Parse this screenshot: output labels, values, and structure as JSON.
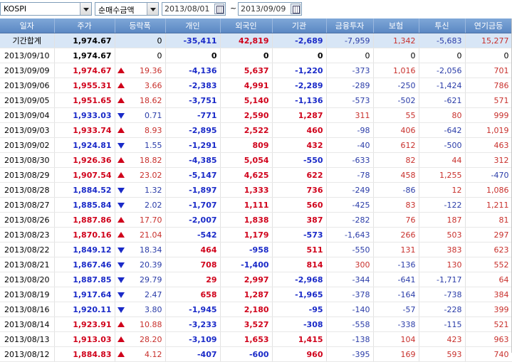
{
  "toolbar": {
    "market": "KOSPI",
    "mode": "순매수금액",
    "start_date": "2013/08/01",
    "separator": "~",
    "end_date": "2013/09/09"
  },
  "columns": [
    "일자",
    "주가",
    "등락폭",
    "개인",
    "외국인",
    "기관",
    "금융투자",
    "보험",
    "투신",
    "연기금등"
  ],
  "rows": [
    {
      "date": "기간합계",
      "close": "1,974.67",
      "dir": "none",
      "chg": "0",
      "ind": "-35,411",
      "for": "42,819",
      "inst": "-2,689",
      "fin": "-7,959",
      "ins": "1,342",
      "trust": "-5,683",
      "pen": "15,277",
      "summary": true
    },
    {
      "date": "2013/09/10",
      "close": "1,974.67",
      "dir": "none",
      "chg": "0",
      "ind": "0",
      "for": "0",
      "inst": "0",
      "fin": "0",
      "ins": "0",
      "trust": "0",
      "pen": "0"
    },
    {
      "date": "2013/09/09",
      "close": "1,974.67",
      "dir": "up",
      "chg": "19.36",
      "ind": "-4,136",
      "for": "5,637",
      "inst": "-1,220",
      "fin": "-373",
      "ins": "1,016",
      "trust": "-2,056",
      "pen": "701"
    },
    {
      "date": "2013/09/06",
      "close": "1,955.31",
      "dir": "up",
      "chg": "3.66",
      "ind": "-2,383",
      "for": "4,991",
      "inst": "-2,289",
      "fin": "-289",
      "ins": "-250",
      "trust": "-1,424",
      "pen": "786"
    },
    {
      "date": "2013/09/05",
      "close": "1,951.65",
      "dir": "up",
      "chg": "18.62",
      "ind": "-3,751",
      "for": "5,140",
      "inst": "-1,136",
      "fin": "-573",
      "ins": "-502",
      "trust": "-621",
      "pen": "571"
    },
    {
      "date": "2013/09/04",
      "close": "1,933.03",
      "dir": "down",
      "chg": "0.71",
      "ind": "-771",
      "for": "2,590",
      "inst": "1,287",
      "fin": "311",
      "ins": "55",
      "trust": "80",
      "pen": "999"
    },
    {
      "date": "2013/09/03",
      "close": "1,933.74",
      "dir": "up",
      "chg": "8.93",
      "ind": "-2,895",
      "for": "2,522",
      "inst": "460",
      "fin": "-98",
      "ins": "406",
      "trust": "-642",
      "pen": "1,019"
    },
    {
      "date": "2013/09/02",
      "close": "1,924.81",
      "dir": "down",
      "chg": "1.55",
      "ind": "-1,291",
      "for": "809",
      "inst": "432",
      "fin": "-40",
      "ins": "612",
      "trust": "-500",
      "pen": "463"
    },
    {
      "date": "2013/08/30",
      "close": "1,926.36",
      "dir": "up",
      "chg": "18.82",
      "ind": "-4,385",
      "for": "5,054",
      "inst": "-550",
      "fin": "-633",
      "ins": "82",
      "trust": "44",
      "pen": "312"
    },
    {
      "date": "2013/08/29",
      "close": "1,907.54",
      "dir": "up",
      "chg": "23.02",
      "ind": "-5,147",
      "for": "4,625",
      "inst": "622",
      "fin": "-78",
      "ins": "458",
      "trust": "1,255",
      "pen": "-470"
    },
    {
      "date": "2013/08/28",
      "close": "1,884.52",
      "dir": "down",
      "chg": "1.32",
      "ind": "-1,897",
      "for": "1,333",
      "inst": "736",
      "fin": "-249",
      "ins": "-86",
      "trust": "12",
      "pen": "1,086"
    },
    {
      "date": "2013/08/27",
      "close": "1,885.84",
      "dir": "down",
      "chg": "2.02",
      "ind": "-1,707",
      "for": "1,111",
      "inst": "560",
      "fin": "-425",
      "ins": "83",
      "trust": "-122",
      "pen": "1,211"
    },
    {
      "date": "2013/08/26",
      "close": "1,887.86",
      "dir": "up",
      "chg": "17.70",
      "ind": "-2,007",
      "for": "1,838",
      "inst": "387",
      "fin": "-282",
      "ins": "76",
      "trust": "187",
      "pen": "81"
    },
    {
      "date": "2013/08/23",
      "close": "1,870.16",
      "dir": "up",
      "chg": "21.04",
      "ind": "-542",
      "for": "1,179",
      "inst": "-573",
      "fin": "-1,643",
      "ins": "266",
      "trust": "503",
      "pen": "297"
    },
    {
      "date": "2013/08/22",
      "close": "1,849.12",
      "dir": "down",
      "chg": "18.34",
      "ind": "464",
      "for": "-958",
      "inst": "511",
      "fin": "-550",
      "ins": "131",
      "trust": "383",
      "pen": "623"
    },
    {
      "date": "2013/08/21",
      "close": "1,867.46",
      "dir": "down",
      "chg": "20.39",
      "ind": "708",
      "for": "-1,400",
      "inst": "814",
      "fin": "300",
      "ins": "-136",
      "trust": "130",
      "pen": "552"
    },
    {
      "date": "2013/08/20",
      "close": "1,887.85",
      "dir": "down",
      "chg": "29.79",
      "ind": "29",
      "for": "2,997",
      "inst": "-2,968",
      "fin": "-344",
      "ins": "-641",
      "trust": "-1,717",
      "pen": "64"
    },
    {
      "date": "2013/08/19",
      "close": "1,917.64",
      "dir": "down",
      "chg": "2.47",
      "ind": "658",
      "for": "1,287",
      "inst": "-1,965",
      "fin": "-378",
      "ins": "-164",
      "trust": "-738",
      "pen": "384"
    },
    {
      "date": "2013/08/16",
      "close": "1,920.11",
      "dir": "down",
      "chg": "3.80",
      "ind": "-1,945",
      "for": "2,180",
      "inst": "-95",
      "fin": "-140",
      "ins": "-57",
      "trust": "-228",
      "pen": "399"
    },
    {
      "date": "2013/08/14",
      "close": "1,923.91",
      "dir": "up",
      "chg": "10.88",
      "ind": "-3,233",
      "for": "3,527",
      "inst": "-308",
      "fin": "-558",
      "ins": "-338",
      "trust": "-115",
      "pen": "521"
    },
    {
      "date": "2013/08/13",
      "close": "1,913.03",
      "dir": "up",
      "chg": "28.20",
      "ind": "-3,109",
      "for": "1,653",
      "inst": "1,415",
      "fin": "-138",
      "ins": "104",
      "trust": "423",
      "pen": "963"
    },
    {
      "date": "2013/08/12",
      "close": "1,884.83",
      "dir": "up",
      "chg": "4.12",
      "ind": "-407",
      "for": "-600",
      "inst": "960",
      "fin": "-395",
      "ins": "169",
      "trust": "593",
      "pen": "740"
    }
  ]
}
